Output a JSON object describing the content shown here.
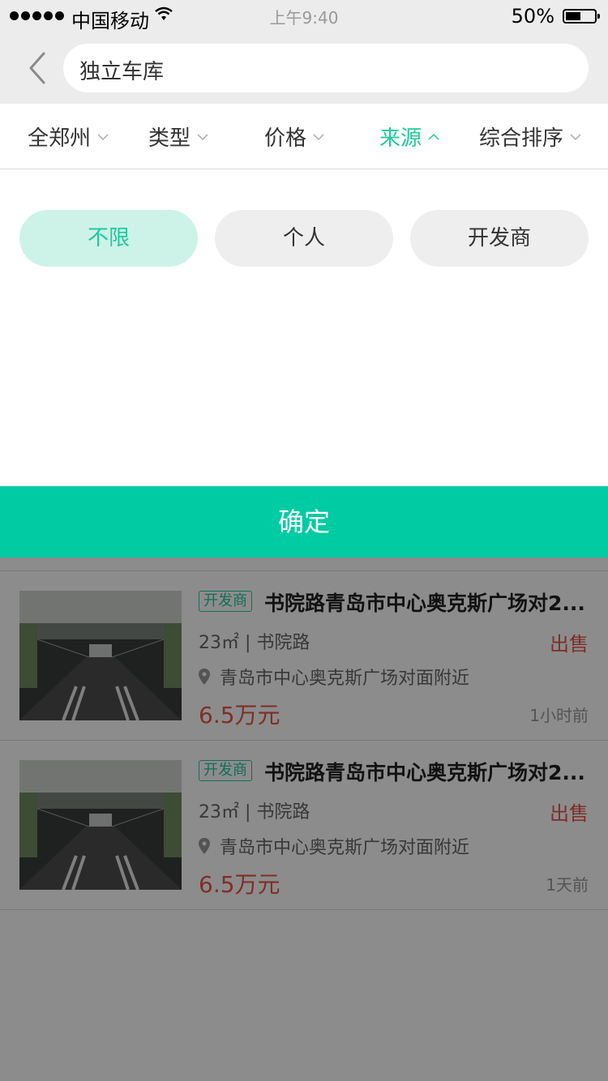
{
  "status_bar": {
    "carrier": "中国移动",
    "time": "上午9:40",
    "battery": "50%"
  },
  "search": {
    "query": "独立车库"
  },
  "filters": [
    {
      "label": "全郑州",
      "active": false
    },
    {
      "label": "类型",
      "active": false
    },
    {
      "label": "价格",
      "active": false
    },
    {
      "label": "来源",
      "active": true
    },
    {
      "label": "综合排序",
      "active": false
    }
  ],
  "source_options": [
    {
      "label": "不限",
      "selected": true
    },
    {
      "label": "个人",
      "selected": false
    },
    {
      "label": "开发商",
      "selected": false
    }
  ],
  "confirm_label": "确定",
  "listings": [
    {
      "tag": "开发商",
      "title": "书院路青岛市中心奥克斯广场对2...",
      "area": "23㎡",
      "road": "书院路",
      "deal": "出售",
      "address": "青岛市中心奥克斯广场对面附近",
      "price": "6.5万元",
      "time": "1小时前"
    },
    {
      "tag": "开发商",
      "title": "书院路青岛市中心奥克斯广场对2...",
      "area": "23㎡",
      "road": "书院路",
      "deal": "出售",
      "address": "青岛市中心奥克斯广场对面附近",
      "price": "6.5万元",
      "time": "1天前"
    }
  ],
  "colors": {
    "accent": "#00cba3",
    "price": "#e85545"
  }
}
